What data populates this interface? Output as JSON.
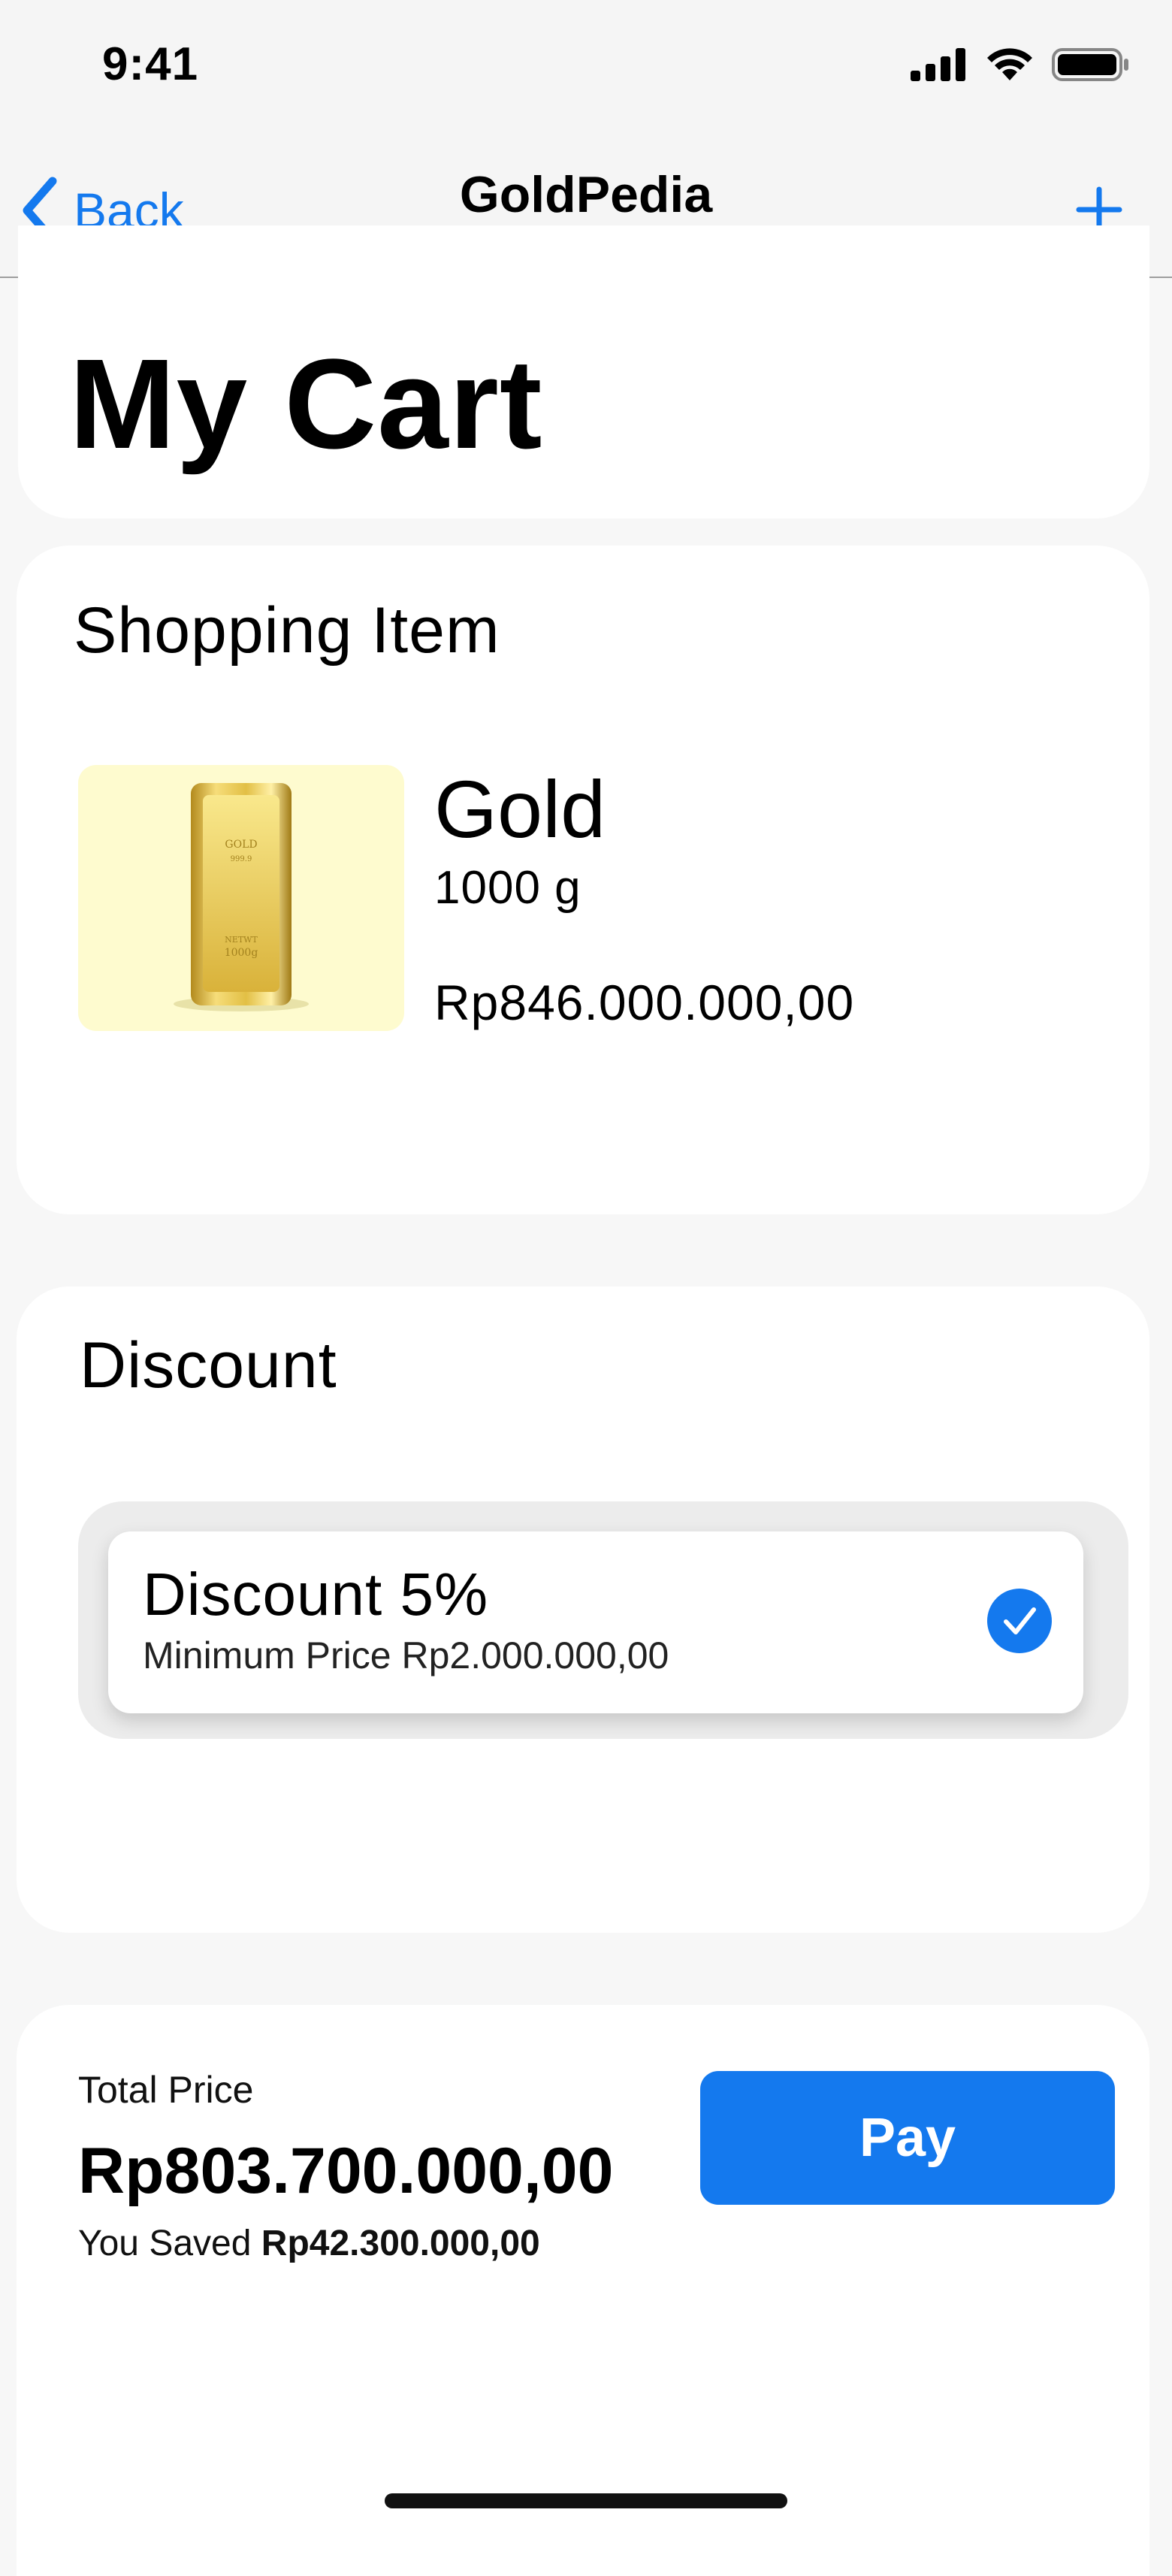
{
  "status": {
    "time": "9:41",
    "icons": [
      "signal-icon",
      "wifi-icon",
      "battery-icon"
    ]
  },
  "nav": {
    "back_label": "Back",
    "title": "GoldPedia",
    "add_icon": "plus-icon"
  },
  "page": {
    "title": "My Cart"
  },
  "shopping": {
    "section_title": "Shopping Item",
    "items": [
      {
        "name": "Gold",
        "weight": "1000 g",
        "price": "Rp846.000.000,00",
        "image_icon": "gold-bar-image"
      }
    ]
  },
  "discount": {
    "section_title": "Discount",
    "options": [
      {
        "name": "Discount 5%",
        "minimum": "Minimum Price Rp2.000.000,00",
        "selected": true
      }
    ]
  },
  "summary": {
    "total_label": "Total Price",
    "total_value": "Rp803.700.000,00",
    "saved_label": "You Saved",
    "saved_value": "Rp42.300.000,00",
    "pay_label": "Pay"
  },
  "colors": {
    "accent": "#1479ee",
    "item_bg": "#fefbcf",
    "page_bg": "#f7f7f7"
  }
}
